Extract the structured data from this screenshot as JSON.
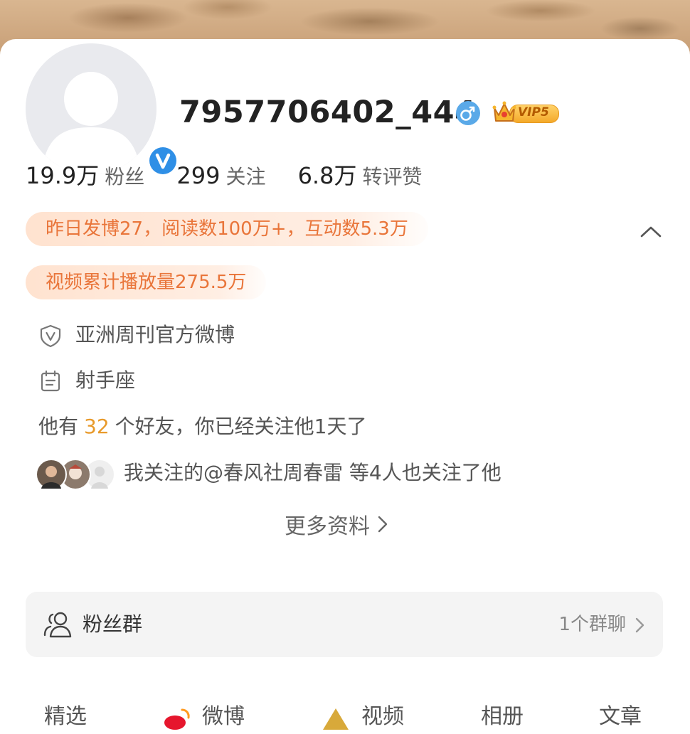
{
  "profile": {
    "username": "7957706402_444",
    "gender_icon": "male-icon",
    "vip_level": "VIP5",
    "verified_icon": "verified-v-icon",
    "avatar": "default-avatar"
  },
  "stats": [
    {
      "value": "19.9万",
      "label": "粉丝"
    },
    {
      "value": "299",
      "label": "关注"
    },
    {
      "value": "6.8万",
      "label": "转评赞"
    }
  ],
  "highlights": {
    "yesterday": "昨日发博27，阅读数100万+，互动数5.3万",
    "video_plays": "视频累计播放量275.5万"
  },
  "info": {
    "verification": "亚洲周刊官方微博",
    "zodiac": "射手座"
  },
  "friends": {
    "prefix": "他有",
    "count": "32",
    "suffix": "个好友，你已经关注他1天了"
  },
  "mutual": {
    "text": "我关注的@春风社周春雷 等4人也关注了他"
  },
  "more_info": {
    "label": "更多资料"
  },
  "fans_group": {
    "label": "粉丝群",
    "count": "1个群聊"
  },
  "tabs": [
    {
      "label": "精选"
    },
    {
      "label": "微博"
    },
    {
      "label": "视频"
    },
    {
      "label": "相册"
    },
    {
      "label": "文章"
    }
  ],
  "colors": {
    "highlight_text": "#e9753a",
    "friends_count": "#e89a2b",
    "verified_blue": "#2f8fe6",
    "gender_blue": "#5aa9e8",
    "vip_gold": "#f4a92a"
  }
}
